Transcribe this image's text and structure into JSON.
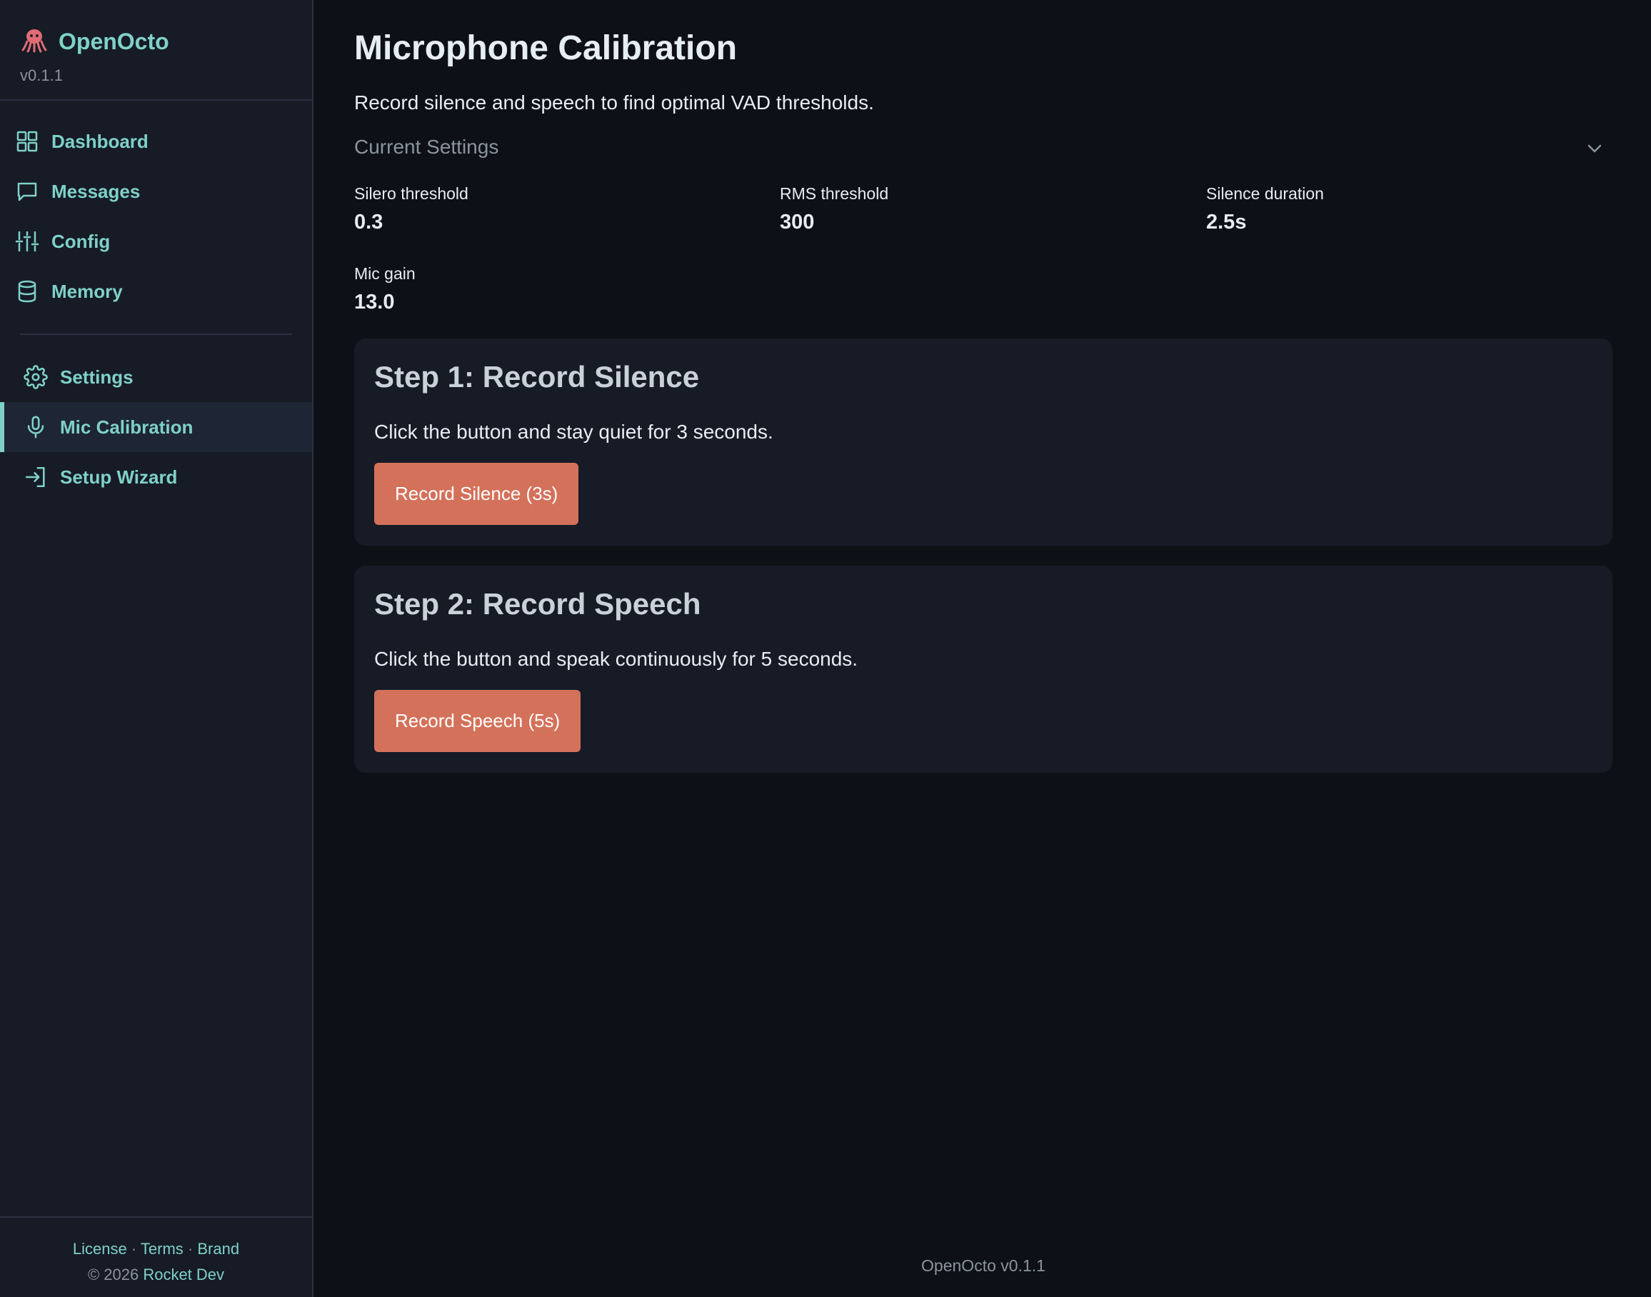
{
  "app": {
    "name": "OpenOcto",
    "version": "v0.1.1"
  },
  "sidebar": {
    "primary_items": [
      {
        "label": "Dashboard",
        "icon": "grid-icon"
      },
      {
        "label": "Messages",
        "icon": "chat-bubble-icon"
      },
      {
        "label": "Config",
        "icon": "sliders-icon"
      },
      {
        "label": "Memory",
        "icon": "database-icon"
      }
    ],
    "secondary_items": [
      {
        "label": "Settings",
        "icon": "gear-icon"
      },
      {
        "label": "Mic Calibration",
        "icon": "microphone-icon",
        "active": true
      },
      {
        "label": "Setup Wizard",
        "icon": "sign-in-icon"
      }
    ],
    "footer": {
      "license": "License",
      "terms": "Terms",
      "brand": "Brand",
      "separator": "·",
      "copyright": "© 2026",
      "company": "Rocket Dev"
    }
  },
  "page": {
    "title": "Microphone Calibration",
    "subtitle": "Record silence and speech to find optimal VAD thresholds."
  },
  "current_settings": {
    "heading": "Current Settings",
    "items": [
      {
        "label": "Silero threshold",
        "value": "0.3"
      },
      {
        "label": "RMS threshold",
        "value": "300"
      },
      {
        "label": "Silence duration",
        "value": "2.5s"
      },
      {
        "label": "Mic gain",
        "value": "13.0"
      }
    ]
  },
  "steps": [
    {
      "title": "Step 1: Record Silence",
      "text": "Click the button and stay quiet for 3 seconds.",
      "button": "Record Silence (3s)"
    },
    {
      "title": "Step 2: Record Speech",
      "text": "Click the button and speak continuously for 5 seconds.",
      "button": "Record Speech (5s)"
    }
  ],
  "footer": {
    "text": "OpenOcto v0.1.1"
  },
  "colors": {
    "accent": "#7fd1c7",
    "button": "#d4715a",
    "background": "#0d1117",
    "sidebar": "#161b26"
  }
}
